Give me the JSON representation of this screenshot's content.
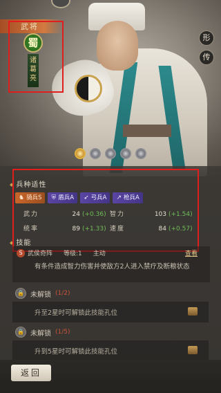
{
  "hero": {
    "title": "武将",
    "faction": "蜀",
    "name_vertical": "诸葛亮"
  },
  "side_buttons": [
    "形",
    "传"
  ],
  "stars": {
    "filled": 1,
    "total": 5
  },
  "troops": {
    "header": "兵种适性",
    "items": [
      {
        "label": "骑兵S",
        "icon": "horse-icon",
        "kind": "cav"
      },
      {
        "label": "盾兵A",
        "icon": "shield-icon",
        "kind": "other"
      },
      {
        "label": "弓兵A",
        "icon": "bow-icon",
        "kind": "other"
      },
      {
        "label": "枪兵A",
        "icon": "spear-icon",
        "kind": "other"
      }
    ]
  },
  "stats": [
    {
      "label": "武力",
      "value": "24",
      "bonus": "(+0.36)"
    },
    {
      "label": "智力",
      "value": "103",
      "bonus": "(+1.54)"
    },
    {
      "label": "统率",
      "value": "89",
      "bonus": "(+1.33)"
    },
    {
      "label": "速度",
      "value": "84",
      "bonus": "(+0.57)"
    }
  ],
  "skills": {
    "header": "技能",
    "main": {
      "icon": "S",
      "name": "武侯奇阵",
      "level": "等级:1",
      "type": "主动",
      "view_label": "查看",
      "description": "有条件造成智力伤害并使敌方2人进入禁疗及断粮状态"
    },
    "locked": [
      {
        "title": "未解锁",
        "count": "(1/2)",
        "text": "升至2星时可解锁此技能孔位"
      },
      {
        "title": "未解锁",
        "count": "(1/5)",
        "text": "升到5星时可解锁此技能孔位"
      }
    ]
  },
  "back_button": "返回"
}
